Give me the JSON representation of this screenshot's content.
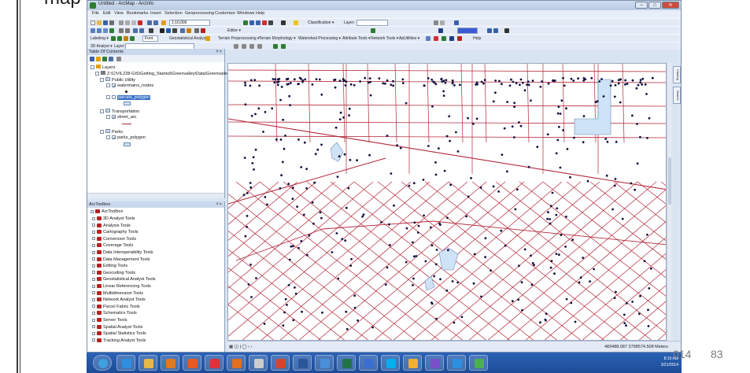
{
  "slide": {
    "title_fragment": "map",
    "footer_date": "014",
    "footer_page": "83"
  },
  "window": {
    "title": "Untitled - ArcMap - ArcInfo",
    "controls": [
      "–",
      "□",
      "✕"
    ]
  },
  "menu": [
    "File",
    "Edit",
    "View",
    "Bookmarks",
    "Insert",
    "Selection",
    "Geoprocessing",
    "Customize",
    "Windows",
    "Help"
  ],
  "toolbars": {
    "scale_value": "1:10,000",
    "classification_label": "Classification ▾",
    "layer_label": "Layer:",
    "editor_label": "Editor ▾",
    "labeling_label": "Labeling ▾",
    "font_value": "Font",
    "geostat_label": "Geostatistical Analyst ▾",
    "terrain_pre": "Terrain Preprocessing ▾",
    "terrain_morph": "Terrain Morphology ▾",
    "watershed": "Watershed Processing ▾",
    "attribute_tools": "Attribute Tools ▾",
    "network_tools": "Network Tools ▾",
    "aputilities": "ApUtilities ▾",
    "help": "Help",
    "analyst3d": "3D Analyst ▾",
    "layer_label2": "Layer:"
  },
  "toc": {
    "header": "Table Of Contents",
    "pin": "ᵠ ×",
    "layers_label": "Layers",
    "path": "Z:\\CIVIL228-GIS\\Getting_Started\\Greenvalley\\Data\\Greenvalle",
    "groups": [
      {
        "name": "Public Utility",
        "layers": [
          {
            "name": "watermains_nodes",
            "selected": false,
            "symbol": "dot"
          },
          {
            "name": "parcels_polygon",
            "selected": true,
            "symbol": "poly"
          }
        ]
      },
      {
        "name": "Transportation",
        "layers": [
          {
            "name": "street_arc",
            "selected": false,
            "symbol": "line"
          }
        ]
      },
      {
        "name": "Parks",
        "layers": [
          {
            "name": "parks_polygon",
            "selected": false,
            "symbol": "poly"
          }
        ]
      }
    ]
  },
  "toolbox": {
    "header": "ArcToolbox",
    "root": "ArcToolbox",
    "items": [
      "3D Analyst Tools",
      "Analysis Tools",
      "Cartography Tools",
      "Conversion Tools",
      "Coverage Tools",
      "Data Interoperability Tools",
      "Data Management Tools",
      "Editing Tools",
      "Geocoding Tools",
      "Geostatistical Analyst Tools",
      "Linear Referencing Tools",
      "Multidimension Tools",
      "Network Analyst Tools",
      "Parcel Fabric Tools",
      "Schematics Tools",
      "Server Tools",
      "Spatial Analyst Tools",
      "Spatial Statistics Tools",
      "Tracking Analyst Tools"
    ]
  },
  "side_tabs": [
    "Catalog",
    "Search"
  ],
  "status": {
    "coordinates": "483488.087  3798574.508 Meters",
    "view_buttons": "▦ ◫ | ◯ ‹ ›"
  },
  "taskbar": {
    "time": "8:10 AM",
    "date": "3/21/2014"
  },
  "colors": {
    "street": "#b3283a",
    "node": "#121240",
    "water": "#cfe3f7",
    "title_bar": "#b9cbe3",
    "taskbar": "#1d4c97"
  }
}
